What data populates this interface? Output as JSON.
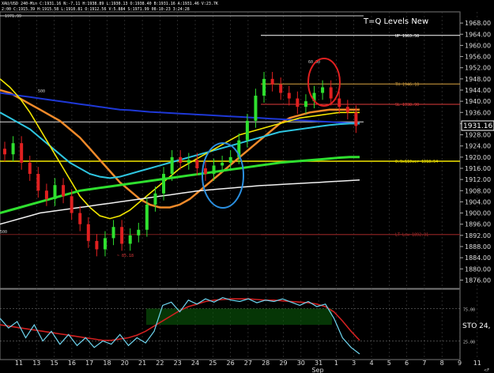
{
  "header": {
    "line1": "XAU/USD  240-Min  C:1931.16  N:-7.11  H:1938.89  L:1930.13  O:1938.40  B:1931.16  A:1931.46  V:23.7K",
    "line2": "2:00  C:1915.39 H:1915.58 L:1910.81 O:1912.56 V:5.884 S:1971.99 08-10-23 3:24:28",
    "left_level": "1971.99"
  },
  "legend_title": "T=Q Levels New",
  "levels": [
    {
      "label": "UP 1963.58",
      "value": 1963.58,
      "color": "#ffffff"
    },
    {
      "label": "TH 1946.18",
      "value": 1946.18,
      "color": "#d9a441"
    },
    {
      "label": "SL 1938.90",
      "value": 1938.9,
      "color": "#e23b3b"
    },
    {
      "label": "0.9x110ver 1918.54",
      "value": 1918.54,
      "color": "#f2e600"
    },
    {
      "label": "LT Low 1892.31",
      "value": 1892.31,
      "color": "#b83232"
    }
  ],
  "annotations": {
    "a_500": "500",
    "left_500": "500",
    "top_peak": "60.00",
    "low": "~ 85.18"
  },
  "price_tag": "1931.16",
  "stoch_label": "STO 24,",
  "stoch_levels": [
    "75.00",
    "25.00"
  ],
  "footer_right": "<F",
  "chart_data": {
    "type": "candlestick",
    "title": "XAU/USD 240-Min",
    "y_axis": {
      "ticks": [
        1968,
        1964,
        1960,
        1956,
        1952,
        1948,
        1944,
        1940,
        1936,
        1932,
        1928,
        1924,
        1920,
        1916,
        1912,
        1908,
        1904,
        1900,
        1896,
        1892,
        1888,
        1884,
        1880,
        1876
      ],
      "tick_labels": [
        "1968.00",
        "1964.00",
        "1960.00",
        "1956.00",
        "1952.00",
        "1948.00",
        "1944.00",
        "1940.00",
        "1936.00",
        "1932.00",
        "1928.00",
        "1924.00",
        "1920.00",
        "1916.00",
        "1912.00",
        "1908.00",
        "1904.00",
        "1900.00",
        "1896.00",
        "1892.00",
        "1888.00",
        "1884.00",
        "1880.00",
        "1876.00"
      ],
      "range": [
        1873,
        1972
      ]
    },
    "x_axis": {
      "labels": [
        "11",
        "13",
        "15",
        "16",
        "17",
        "18",
        "20",
        "21",
        "22",
        "23",
        "24",
        "25",
        "26",
        "27",
        "28",
        "29",
        "30",
        "31",
        "1",
        "3",
        "4",
        "5",
        "6",
        "7",
        "8",
        "9",
        "11"
      ],
      "month_label": "Sep"
    },
    "candles_close": [
      1921,
      1925,
      1918,
      1914,
      1908,
      1905,
      1910,
      1906,
      1900,
      1896,
      1890,
      1887,
      1891,
      1895,
      1889,
      1892,
      1894,
      1903,
      1907,
      1914,
      1920,
      1918,
      1919,
      1916,
      1914,
      1917,
      1918,
      1920,
      1926,
      1933,
      1942,
      1948,
      1946,
      1943,
      1941,
      1938,
      1940,
      1943,
      1945,
      1941,
      1938,
      1936,
      1931.16
    ],
    "series": [
      {
        "name": "MA orange",
        "values": [
          1944,
          1943,
          1941,
          1939,
          1937,
          1935,
          1933,
          1930,
          1927,
          1923,
          1919,
          1915,
          1911,
          1908,
          1905,
          1903,
          1902,
          1902,
          1903,
          1905,
          1908,
          1911,
          1914,
          1917,
          1920,
          1923,
          1926,
          1929,
          1932,
          1934,
          1935,
          1936,
          1936.5,
          1937,
          1937,
          1937,
          1937
        ]
      },
      {
        "name": "MA blue",
        "values": [
          1943,
          1942.5,
          1942,
          1941.5,
          1941,
          1940.5,
          1940,
          1939.5,
          1939,
          1938.5,
          1938,
          1937.5,
          1937,
          1936.8,
          1936.5,
          1936.2,
          1936,
          1935.8,
          1935.6,
          1935.4,
          1935.2,
          1935,
          1934.8,
          1934.6,
          1934.4,
          1934.2,
          1934,
          1933.8,
          1933.6,
          1933.4,
          1933.2,
          1933,
          1932.8,
          1932.6,
          1932.4,
          1932.2,
          1932
        ]
      },
      {
        "name": "MA cyan",
        "values": [
          1936,
          1934,
          1932,
          1930,
          1927,
          1924,
          1921,
          1918,
          1916,
          1914,
          1913,
          1912.5,
          1913,
          1914,
          1915,
          1916,
          1917,
          1918,
          1919,
          1920,
          1921,
          1922,
          1923,
          1924,
          1925,
          1926,
          1927,
          1928,
          1929,
          1929.5,
          1930,
          1930.5,
          1931,
          1931.5,
          1931.8,
          1932,
          1932
        ]
      },
      {
        "name": "MA yellow",
        "values": [
          1948,
          1945,
          1941,
          1936,
          1930,
          1924,
          1918,
          1912,
          1906,
          1902,
          1899,
          1898,
          1899,
          1901,
          1904,
          1907,
          1910,
          1913,
          1916,
          1918,
          1920,
          1922,
          1924,
          1926,
          1928,
          1929,
          1930,
          1931,
          1932,
          1933,
          1934,
          1934.5,
          1935,
          1935.5,
          1936,
          1936,
          1936
        ]
      },
      {
        "name": "MA green",
        "values": [
          1900,
          1901,
          1902,
          1903,
          1904,
          1905,
          1906,
          1907,
          1908,
          1908.5,
          1909,
          1909.5,
          1910,
          1910.5,
          1911,
          1911.5,
          1912,
          1912.5,
          1913,
          1913.5,
          1914,
          1914.5,
          1915,
          1915.5,
          1916,
          1916.5,
          1917,
          1917.5,
          1918,
          1918.3,
          1918.6,
          1918.9,
          1919.2,
          1919.5,
          1919.8,
          1920,
          1920
        ]
      },
      {
        "name": "MA white",
        "values": [
          1896,
          1897,
          1898,
          1899,
          1900,
          1900.5,
          1901,
          1901.5,
          1902,
          1902.5,
          1903,
          1903.5,
          1904,
          1904.5,
          1905,
          1905.5,
          1906,
          1906.5,
          1907,
          1907.5,
          1908,
          1908.3,
          1908.6,
          1908.9,
          1909.2,
          1909.5,
          1909.8,
          1910,
          1910.2,
          1910.4,
          1910.6,
          1910.8,
          1911,
          1911.2,
          1911.4,
          1911.6,
          1911.8
        ]
      }
    ],
    "stochastic": {
      "range": [
        0,
        100
      ],
      "fast": [
        60,
        45,
        55,
        30,
        50,
        25,
        40,
        20,
        35,
        18,
        30,
        15,
        25,
        20,
        35,
        18,
        30,
        22,
        40,
        80,
        85,
        70,
        88,
        82,
        90,
        85,
        92,
        88,
        86,
        90,
        84,
        88,
        86,
        90,
        85,
        80,
        86,
        78,
        82,
        60,
        30,
        15,
        5
      ],
      "slow": [
        50,
        48,
        46,
        44,
        42,
        40,
        38,
        36,
        34,
        32,
        30,
        28,
        26,
        26,
        28,
        30,
        34,
        40,
        48,
        56,
        64,
        72,
        78,
        82,
        86,
        88,
        89,
        90,
        90,
        90,
        89,
        88,
        88,
        87,
        86,
        85,
        84,
        82,
        78,
        70,
        56,
        40,
        26
      ]
    }
  }
}
